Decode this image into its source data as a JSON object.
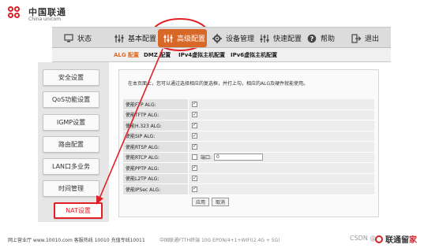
{
  "brand": {
    "name_cn": "中国联通",
    "name_en": "China unicom"
  },
  "nav": [
    {
      "label": "状态",
      "icon": "monitor-icon"
    },
    {
      "label": "基本配置",
      "icon": "sliders-icon"
    },
    {
      "label": "高级配置",
      "icon": "sliders-icon",
      "active": true
    },
    {
      "label": "设备管理",
      "icon": "gear-icon"
    },
    {
      "label": "快速配置",
      "icon": "sliders-icon"
    },
    {
      "label": "帮助",
      "icon": "help-icon"
    },
    {
      "label": "退出",
      "icon": "exit-icon"
    }
  ],
  "subtabs": [
    "ALG 配置",
    "DMZ 配置",
    "IPv4虚拟主机配置",
    "IPv6虚拟主机配置"
  ],
  "sidebar": [
    "安全设置",
    "QoS功能设置",
    "IGMP设置",
    "路由配置",
    "LAN口多业务",
    "时间管理",
    "NAT设置"
  ],
  "main": {
    "description": "在本页面上，您可以通过选择相应的复选框，并打上勾，相应的ALG及硬件就能使用。",
    "rows": [
      {
        "label": "使能FTP ALG:",
        "checked": true
      },
      {
        "label": "使能TFTP ALG:",
        "checked": true
      },
      {
        "label": "使能H.323 ALG:",
        "checked": true
      },
      {
        "label": "使能SIP ALG:",
        "checked": true
      },
      {
        "label": "使能RTSP ALG:",
        "checked": true
      },
      {
        "label": "使能RTCP ALG:",
        "checked": false,
        "port_label": "端口:",
        "port_value": "0"
      },
      {
        "label": "使能PPTP ALG:",
        "checked": true
      },
      {
        "label": "使能L2TP ALG:",
        "checked": true
      },
      {
        "label": "使能IPSec ALG:",
        "checked": true
      }
    ],
    "apply": "应用",
    "cancel": "取消"
  },
  "footer": {
    "left": "网上营业厅 www.10010.com  客服热线  10010  充值专线10011",
    "center": "中国联通FTTH终端 10G EPON/4+1+WIFI(2.4G + 5G)",
    "watermark": "CSDN @",
    "brand_text": "联通留",
    "brand_red": "家"
  },
  "accent": "#d86828",
  "annotation_color": "#e21e26"
}
